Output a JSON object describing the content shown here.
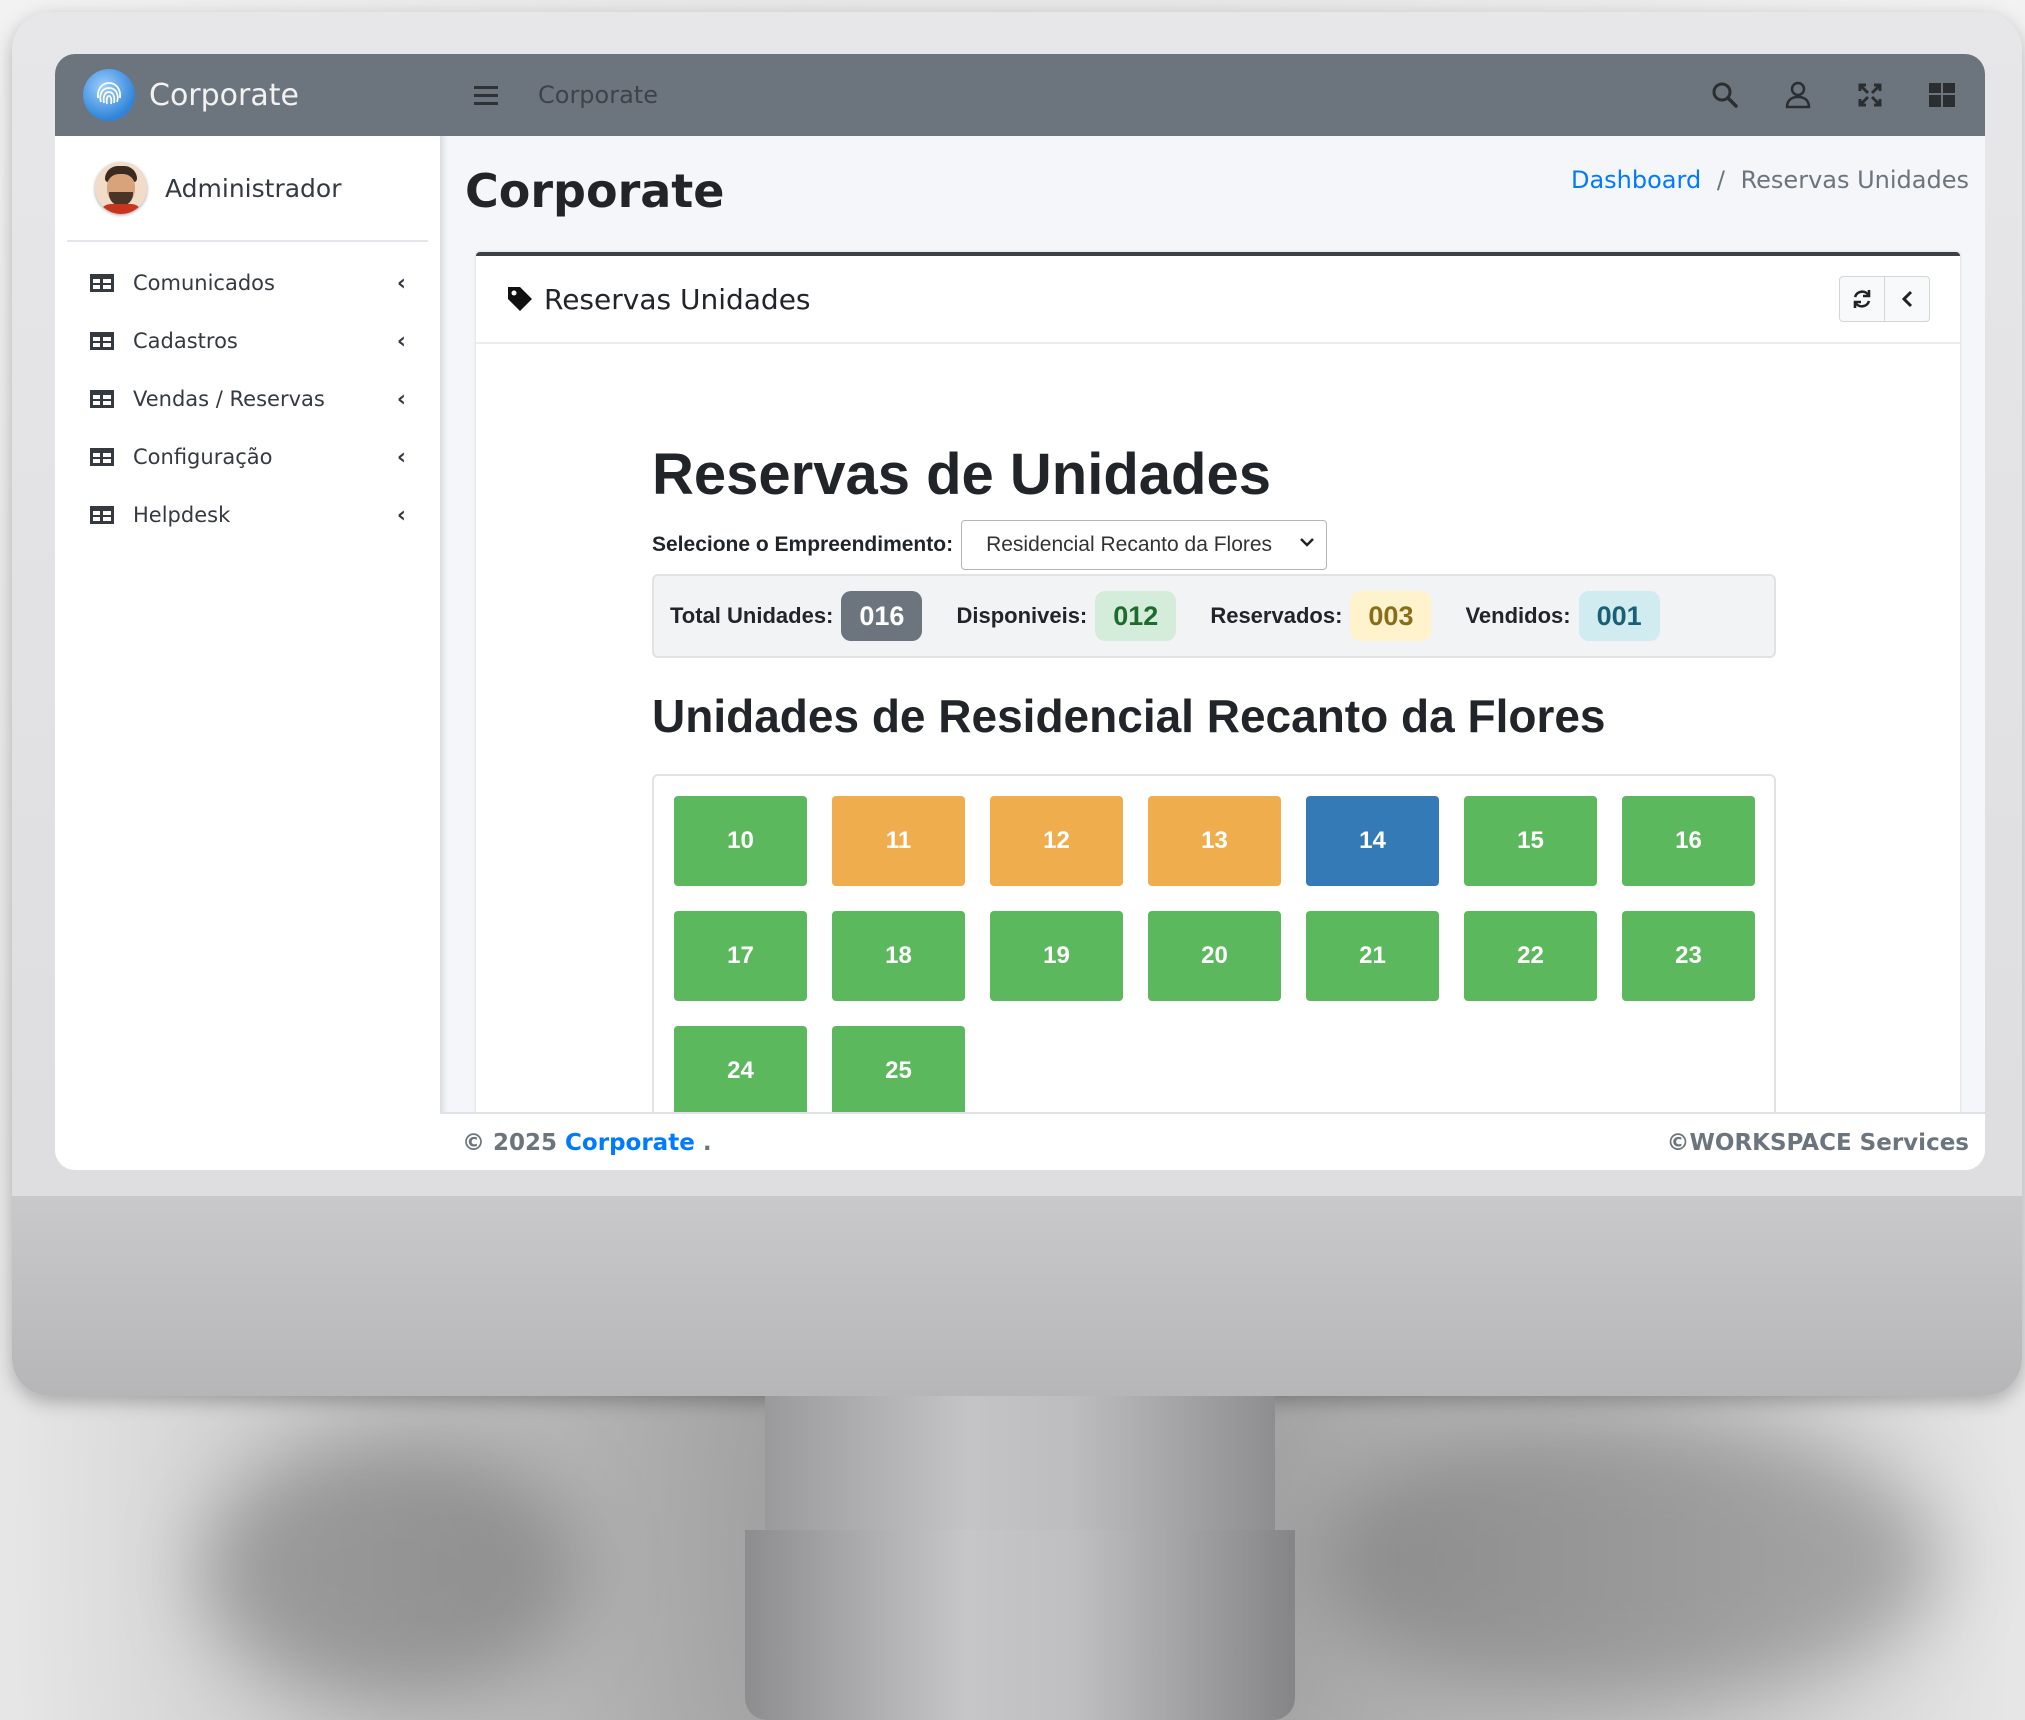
{
  "app": {
    "brand": "Corporate",
    "user": "Administrador"
  },
  "sidebar": {
    "items": [
      {
        "label": "Comunicados"
      },
      {
        "label": "Cadastros"
      },
      {
        "label": "Vendas / Reservas"
      },
      {
        "label": "Configuração"
      },
      {
        "label": "Helpdesk"
      }
    ]
  },
  "topbar": {
    "title": "Corporate"
  },
  "header": {
    "page_title": "Corporate",
    "breadcrumb": {
      "link": "Dashboard",
      "separator": "/",
      "current": "Reservas Unidades"
    }
  },
  "card": {
    "title": "Reservas Unidades"
  },
  "main": {
    "heading": "Reservas de Unidades",
    "select_label": "Selecione o Empreendimento:",
    "select_value": "Residencial Recanto da Flores",
    "summary": {
      "total_label": "Total Unidades:",
      "total_value": "016",
      "disp_label": "Disponiveis:",
      "disp_value": "012",
      "res_label": "Reservados:",
      "res_value": "003",
      "vend_label": "Vendidos:",
      "vend_value": "001"
    },
    "units_heading": "Unidades de Residencial Recanto da Flores",
    "units": [
      {
        "number": "10",
        "status": "disponivel"
      },
      {
        "number": "11",
        "status": "reservado"
      },
      {
        "number": "12",
        "status": "reservado"
      },
      {
        "number": "13",
        "status": "reservado"
      },
      {
        "number": "14",
        "status": "vendido"
      },
      {
        "number": "15",
        "status": "disponivel"
      },
      {
        "number": "16",
        "status": "disponivel"
      },
      {
        "number": "17",
        "status": "disponivel"
      },
      {
        "number": "18",
        "status": "disponivel"
      },
      {
        "number": "19",
        "status": "disponivel"
      },
      {
        "number": "20",
        "status": "disponivel"
      },
      {
        "number": "21",
        "status": "disponivel"
      },
      {
        "number": "22",
        "status": "disponivel"
      },
      {
        "number": "23",
        "status": "disponivel"
      },
      {
        "number": "24",
        "status": "disponivel"
      },
      {
        "number": "25",
        "status": "disponivel"
      }
    ]
  },
  "footer": {
    "copyright": "© 2025",
    "brand": "Corporate",
    "dot": ".",
    "right": "©WORKSPACE Services"
  },
  "colors": {
    "topbar": "#6c757d",
    "disponivel": "#5cb85c",
    "reservado": "#f0ad4e",
    "vendido": "#337ab7",
    "link": "#007bff"
  },
  "icons": [
    "fingerprint-icon",
    "hamburger-icon",
    "search-icon",
    "user-icon",
    "expand-icon",
    "grid-icon",
    "table-icon",
    "chevron-left-icon",
    "tag-icon",
    "refresh-icon",
    "chevron-down-icon"
  ]
}
